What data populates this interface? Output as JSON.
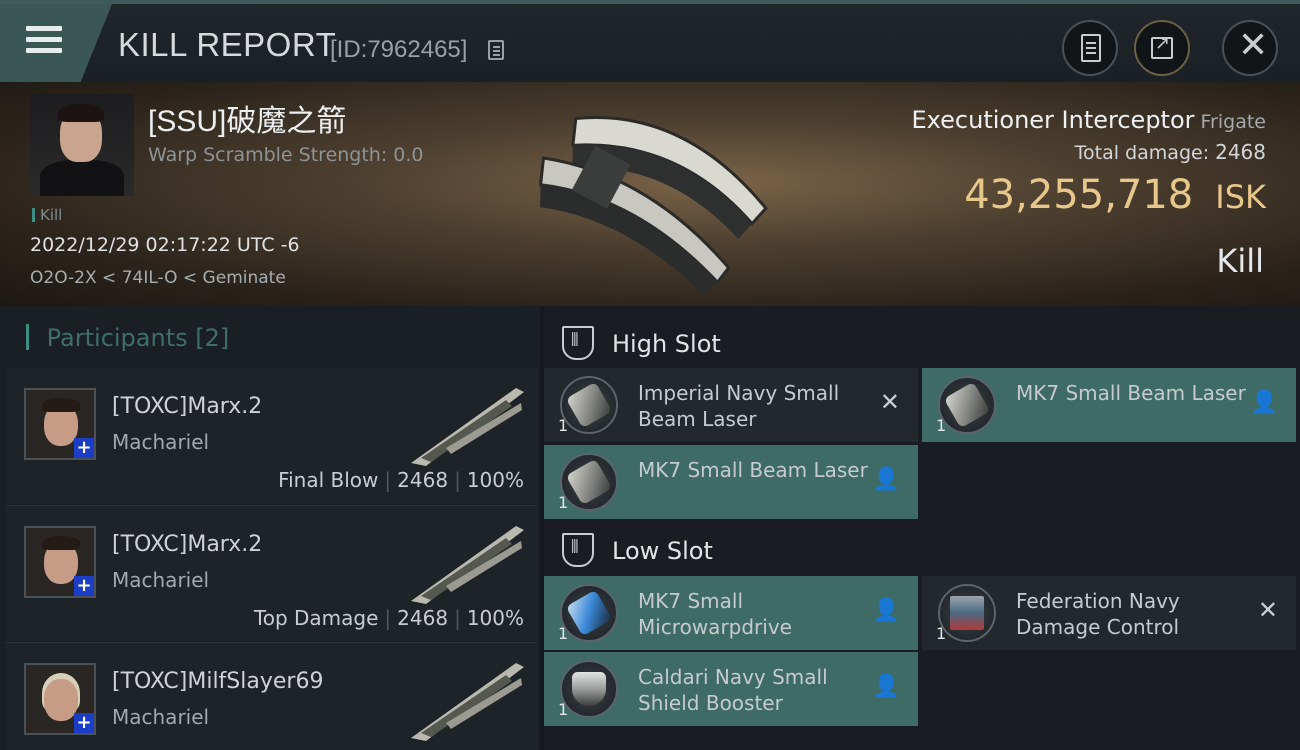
{
  "header": {
    "title": "KILL REPORT",
    "report_id": "[ID:7962465]"
  },
  "victim": {
    "name": "[SSU]破魔之箭",
    "warp_scramble": "Warp Scramble Strength: 0.0",
    "kill_tag": "Kill",
    "datetime": "2022/12/29 02:17:22 UTC -6",
    "location": "O2O-2X < 74IL-O < Geminate"
  },
  "ship": {
    "name": "Executioner Interceptor",
    "class": "Frigate",
    "total_damage_label": "Total damage:",
    "total_damage": "2468",
    "isk_value": "43,255,718",
    "isk_unit": "ISK",
    "kill_type": "Kill"
  },
  "participants": {
    "label": "Participants",
    "count": "[2]",
    "items": [
      {
        "name": "[TOXC]Marx.2",
        "ship": "Machariel",
        "role": "Final Blow",
        "damage": "2468",
        "percent": "100%"
      },
      {
        "name": "[TOXC]Marx.2",
        "ship": "Machariel",
        "role": "Top Damage",
        "damage": "2468",
        "percent": "100%"
      },
      {
        "name": "[TOXC]MilfSlayer69",
        "ship": "Machariel"
      }
    ]
  },
  "fittings": {
    "high_slot_label": "High Slot",
    "low_slot_label": "Low Slot",
    "high": [
      {
        "qty": "1",
        "name": "Imperial Navy Small Beam Laser",
        "status": "destroyed"
      },
      {
        "qty": "1",
        "name": "MK7 Small Beam Laser",
        "status": "dropped"
      },
      {
        "qty": "1",
        "name": "MK7 Small Beam Laser",
        "status": "dropped"
      }
    ],
    "low": [
      {
        "qty": "1",
        "name": "MK7 Small Microwarpdrive",
        "status": "dropped"
      },
      {
        "qty": "1",
        "name": "Federation Navy Damage Control",
        "status": "destroyed"
      },
      {
        "qty": "1",
        "name": "Caldari Navy Small Shield Booster",
        "status": "dropped"
      }
    ]
  },
  "colors": {
    "accent_teal": "#3e6b66",
    "isk_gold": "#e8c78a",
    "plus_blue": "#1c3ec6"
  }
}
